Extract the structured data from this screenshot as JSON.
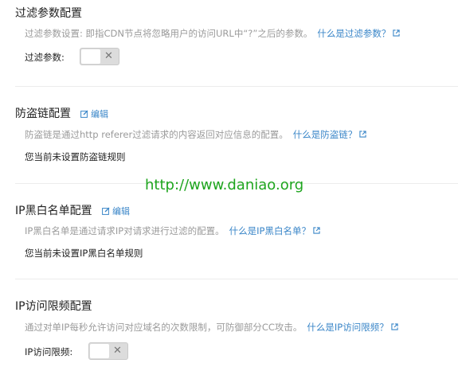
{
  "filter_section": {
    "title": "过滤参数配置",
    "description": "过滤参数设置: 即指CDN节点将忽略用户的访问URL中“?”之后的参数。",
    "help_link": "什么是过滤参数？",
    "toggle_label": "过滤参数:",
    "toggle_state": "off"
  },
  "hotlink_section": {
    "title": "防盗链配置",
    "edit_label": "编辑",
    "description": "防盗链是通过http referer过滤请求的内容返回对应信息的配置。",
    "help_link": "什么是防盗链？",
    "status": "您当前未设置防盗链规则"
  },
  "ip_list_section": {
    "title": "IP黑白名单配置",
    "edit_label": "编辑",
    "description": "IP黑白名单是通过请求IP对请求进行过滤的配置。",
    "help_link": "什么是IP黑白名单？",
    "status": "您当前未设置IP黑白名单规则"
  },
  "ip_rate_section": {
    "title": "IP访问限频配置",
    "description": "通过对单IP每秒允许访问对应域名的次数限制，可防御部分CC攻击。",
    "help_link": "什么是IP访问限频？",
    "toggle_label": "IP访问限频:",
    "toggle_state": "off"
  },
  "watermark": "http://www.daniao.org",
  "colors": {
    "link": "#3a86c8",
    "description": "#9a9a9a",
    "watermark": "#1ea51e",
    "toggle_bg": "#dcdcdc"
  },
  "icons": {
    "edit": "edit-icon",
    "external": "external-link-icon",
    "toggle_off": "close-icon"
  }
}
